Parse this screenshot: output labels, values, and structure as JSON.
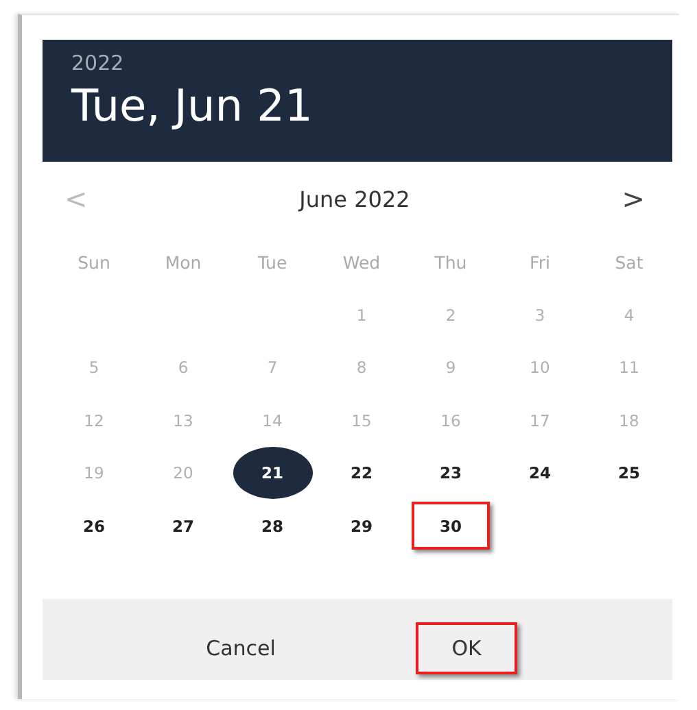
{
  "header": {
    "year": "2022",
    "date": "Tue, Jun 21"
  },
  "nav": {
    "prev": "<",
    "month": "June 2022",
    "next": ">"
  },
  "weekdays": [
    "Sun",
    "Mon",
    "Tue",
    "Wed",
    "Thu",
    "Fri",
    "Sat"
  ],
  "weeks": [
    {
      "kind": "lead",
      "days": [
        {
          "day": "1",
          "disabled": true,
          "selected": false,
          "highlighted": false
        },
        {
          "day": "2",
          "disabled": true,
          "selected": false,
          "highlighted": false
        },
        {
          "day": "3",
          "disabled": true,
          "selected": false,
          "highlighted": false
        },
        {
          "day": "4",
          "disabled": true,
          "selected": false,
          "highlighted": false
        }
      ]
    },
    {
      "kind": "full",
      "days": [
        {
          "day": "5",
          "disabled": true,
          "selected": false,
          "highlighted": false
        },
        {
          "day": "6",
          "disabled": true,
          "selected": false,
          "highlighted": false
        },
        {
          "day": "7",
          "disabled": true,
          "selected": false,
          "highlighted": false
        },
        {
          "day": "8",
          "disabled": true,
          "selected": false,
          "highlighted": false
        },
        {
          "day": "9",
          "disabled": true,
          "selected": false,
          "highlighted": false
        },
        {
          "day": "10",
          "disabled": true,
          "selected": false,
          "highlighted": false
        },
        {
          "day": "11",
          "disabled": true,
          "selected": false,
          "highlighted": false
        }
      ]
    },
    {
      "kind": "full",
      "days": [
        {
          "day": "12",
          "disabled": true,
          "selected": false,
          "highlighted": false
        },
        {
          "day": "13",
          "disabled": true,
          "selected": false,
          "highlighted": false
        },
        {
          "day": "14",
          "disabled": true,
          "selected": false,
          "highlighted": false
        },
        {
          "day": "15",
          "disabled": true,
          "selected": false,
          "highlighted": false
        },
        {
          "day": "16",
          "disabled": true,
          "selected": false,
          "highlighted": false
        },
        {
          "day": "17",
          "disabled": true,
          "selected": false,
          "highlighted": false
        },
        {
          "day": "18",
          "disabled": true,
          "selected": false,
          "highlighted": false
        }
      ]
    },
    {
      "kind": "full",
      "days": [
        {
          "day": "19",
          "disabled": true,
          "selected": false,
          "highlighted": false
        },
        {
          "day": "20",
          "disabled": true,
          "selected": false,
          "highlighted": false
        },
        {
          "day": "21",
          "disabled": false,
          "selected": true,
          "highlighted": false
        },
        {
          "day": "22",
          "disabled": false,
          "selected": false,
          "highlighted": false
        },
        {
          "day": "23",
          "disabled": false,
          "selected": false,
          "highlighted": false
        },
        {
          "day": "24",
          "disabled": false,
          "selected": false,
          "highlighted": false
        },
        {
          "day": "25",
          "disabled": false,
          "selected": false,
          "highlighted": false
        }
      ]
    },
    {
      "kind": "tail",
      "days": [
        {
          "day": "26",
          "disabled": false,
          "selected": false,
          "highlighted": false
        },
        {
          "day": "27",
          "disabled": false,
          "selected": false,
          "highlighted": false
        },
        {
          "day": "28",
          "disabled": false,
          "selected": false,
          "highlighted": false
        },
        {
          "day": "29",
          "disabled": false,
          "selected": false,
          "highlighted": false
        },
        {
          "day": "30",
          "disabled": false,
          "selected": false,
          "highlighted": true
        }
      ]
    }
  ],
  "buttons": [
    {
      "label": "Cancel",
      "highlighted": false
    },
    {
      "label": "OK",
      "highlighted": true
    }
  ]
}
